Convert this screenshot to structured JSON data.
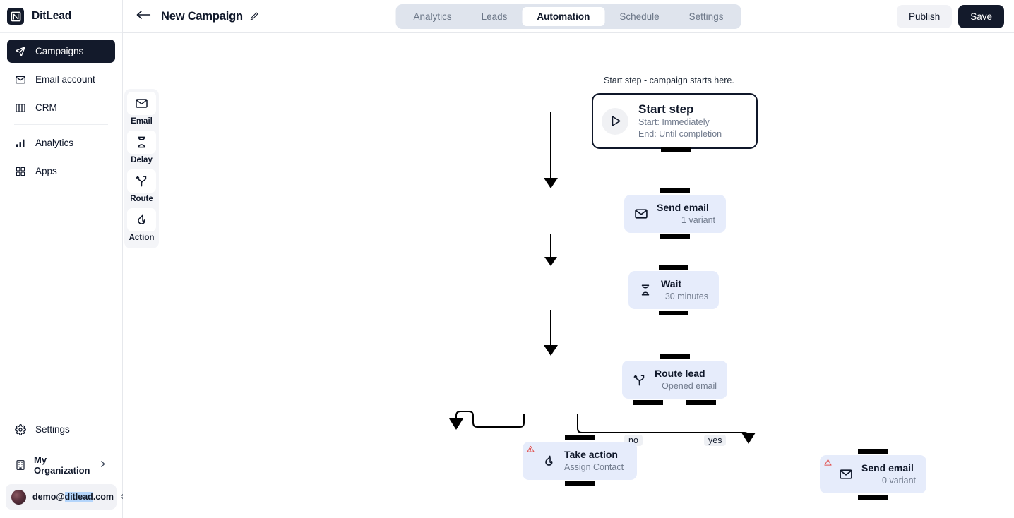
{
  "brand": {
    "name": "DitLead",
    "logo_icon": "logo-n-mark"
  },
  "sidebar": {
    "items": [
      {
        "label": "Campaigns",
        "icon": "paper-plane-icon",
        "active": true
      },
      {
        "label": "Email account",
        "icon": "envelope-icon",
        "active": false
      },
      {
        "label": "CRM",
        "icon": "columns-icon",
        "active": false
      },
      {
        "label": "Analytics",
        "icon": "bar-chart-icon",
        "active": false
      },
      {
        "label": "Apps",
        "icon": "grid-squares-icon",
        "active": false
      }
    ],
    "settings": {
      "label": "Settings",
      "icon": "gear-icon"
    },
    "organization": {
      "label": "My Organization",
      "icon": "building-icon",
      "chevron": "chevron-right-icon"
    },
    "account": {
      "email_prefix": "demo@",
      "email_selected": "ditlead",
      "email_suffix": ".com",
      "stepper_icon": "chevron-up-down-icon"
    }
  },
  "topbar": {
    "back_icon": "arrow-left-icon",
    "title": "New Campaign",
    "edit_icon": "pencil-icon",
    "tabs": [
      {
        "label": "Analytics",
        "active": false
      },
      {
        "label": "Leads",
        "active": false
      },
      {
        "label": "Automation",
        "active": true
      },
      {
        "label": "Schedule",
        "active": false
      },
      {
        "label": "Settings",
        "active": false
      }
    ],
    "publish_label": "Publish",
    "save_label": "Save"
  },
  "palette": [
    {
      "label": "Email",
      "icon": "envelope-icon"
    },
    {
      "label": "Delay",
      "icon": "hourglass-icon"
    },
    {
      "label": "Route",
      "icon": "branch-arrow-icon"
    },
    {
      "label": "Action",
      "icon": "flame-icon"
    }
  ],
  "canvas": {
    "start_caption": "Start step - campaign starts here.",
    "nodes": {
      "start": {
        "title": "Start step",
        "line1": "Start: Immediately",
        "line2": "End: Until completion",
        "icon": "play-icon"
      },
      "send_email_1": {
        "title": "Send email",
        "sub": "1 variant",
        "icon": "envelope-icon"
      },
      "wait": {
        "title": "Wait",
        "sub": "30 minutes",
        "icon": "hourglass-icon"
      },
      "route": {
        "title": "Route lead",
        "sub": "Opened email",
        "icon": "branch-arrow-icon"
      },
      "take_action": {
        "title": "Take action",
        "sub": "Assign Contact",
        "icon": "flame-icon",
        "warning_icon": "warning-triangle-icon"
      },
      "send_email_2": {
        "title": "Send email",
        "sub": "0 variant",
        "icon": "envelope-icon",
        "warning_icon": "warning-triangle-icon"
      }
    },
    "edge_labels": {
      "no": "no",
      "yes": "yes"
    }
  },
  "colors": {
    "node_bg": "#e6ecfb",
    "accent_dark": "#131a2b",
    "tabbar_bg": "#dfe4ed",
    "warning": "#e1514f"
  }
}
